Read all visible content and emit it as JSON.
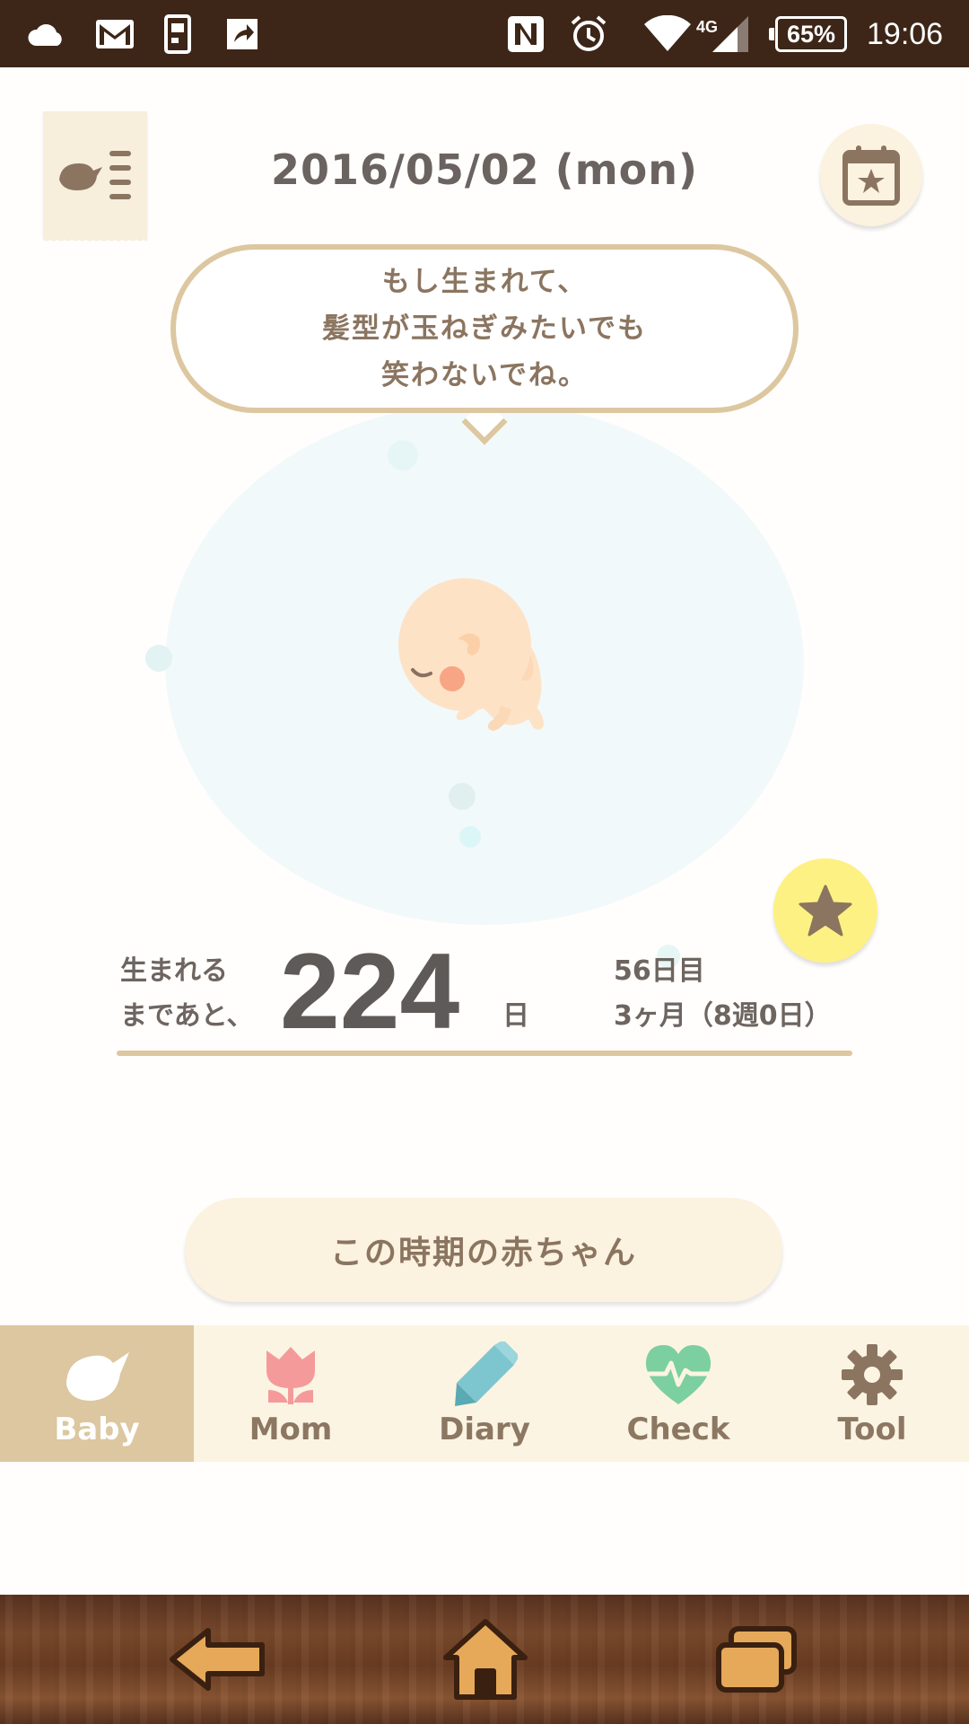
{
  "status_bar": {
    "battery": "65%",
    "network": "4G",
    "time": "19:06"
  },
  "header": {
    "date": "2016/05/02 (mon)"
  },
  "bubble": {
    "lines": [
      "もし生まれて、",
      "髪型が玉ねぎみたいでも",
      "笑わないでね。"
    ]
  },
  "countdown": {
    "label_line1": "生まれる",
    "label_line2": "まであと、",
    "days": "224",
    "unit": "日",
    "day_count": "56日目",
    "week_info": "3ヶ月（8週0日）"
  },
  "period_button": "この時期の赤ちゃん",
  "tabs": [
    {
      "label": "Baby",
      "icon": "bird-icon"
    },
    {
      "label": "Mom",
      "icon": "tulip-icon"
    },
    {
      "label": "Diary",
      "icon": "pencil-icon"
    },
    {
      "label": "Check",
      "icon": "heart-pulse-icon"
    },
    {
      "label": "Tool",
      "icon": "gear-icon"
    }
  ],
  "active_tab": "Baby",
  "colors": {
    "status_bar": "#3d2618",
    "accent_tan": "#dcc7a0",
    "cream": "#fbf2df",
    "star_yellow": "#fdf183",
    "text_brown": "#8b7560"
  }
}
